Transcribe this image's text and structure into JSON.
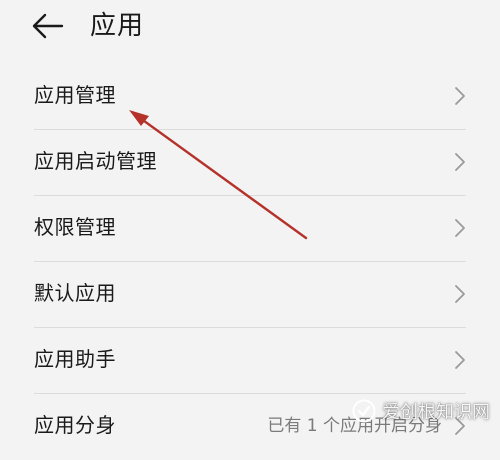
{
  "header": {
    "back_icon": "arrow-left-icon",
    "title": "应用"
  },
  "list": {
    "items": [
      {
        "label": "应用管理"
      },
      {
        "label": "应用启动管理"
      },
      {
        "label": "权限管理"
      },
      {
        "label": "默认应用"
      },
      {
        "label": "应用助手"
      },
      {
        "label": "应用分身",
        "value": "已有 1 个应用开启分身"
      }
    ]
  },
  "annotation": {
    "arrow_color": "#b5322b"
  },
  "watermark": {
    "text": "爱创根知识网"
  }
}
